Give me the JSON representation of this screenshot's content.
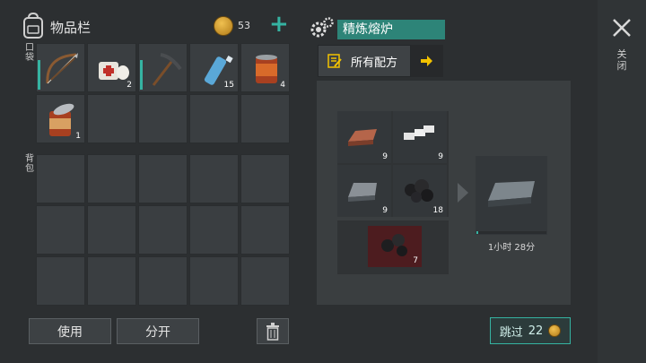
{
  "inventory": {
    "title": "物品栏",
    "coins": "53",
    "pocket_label": "口袋",
    "bag_label": "背包",
    "pocket_items": [
      {
        "name": "bow",
        "count": ""
      },
      {
        "name": "bandage",
        "count": "2"
      },
      {
        "name": "pickaxe",
        "count": ""
      },
      {
        "name": "water-bottle",
        "count": "15"
      },
      {
        "name": "canned-food",
        "count": "4"
      },
      {
        "name": "canned-food-open",
        "count": "1"
      }
    ]
  },
  "actions": {
    "use_label": "使用",
    "split_label": "分开"
  },
  "furnace": {
    "title": "精炼熔炉",
    "recipes_label": "所有配方",
    "inputs": [
      {
        "name": "copper-ingot",
        "count": "9"
      },
      {
        "name": "silver-bars",
        "count": "9"
      },
      {
        "name": "iron-ingot",
        "count": "9"
      },
      {
        "name": "coal",
        "count": "18"
      }
    ],
    "fuel": {
      "name": "coal-fuel",
      "count": "7"
    },
    "output": {
      "name": "steel-ingot"
    },
    "timer": "1小时 28分",
    "progress": 0.03,
    "skip_label": "跳过",
    "skip_cost": "22"
  },
  "close_label": "关闭",
  "colors": {
    "accent": "#35b3a2",
    "title_bg": "#2d8478",
    "arrow": "#f2c200"
  }
}
